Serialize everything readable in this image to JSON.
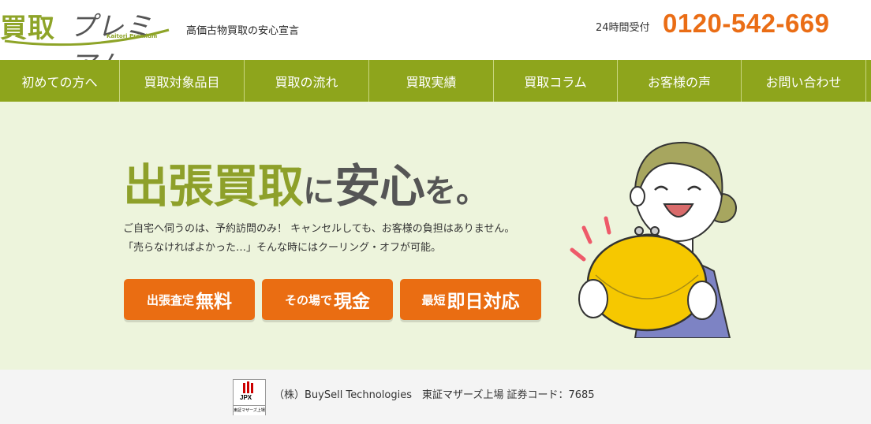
{
  "header": {
    "logo_kanji": "買取",
    "logo_kana": "プレミアム",
    "logo_roman": "Kaitori Premium",
    "tagline": "高価古物買取の安心宣言",
    "hours_label": "24時間受付",
    "phone": "0120-542-669"
  },
  "nav": {
    "items": [
      {
        "label": "初めての方へ"
      },
      {
        "label": "買取対象品目"
      },
      {
        "label": "買取の流れ"
      },
      {
        "label": "買取実績"
      },
      {
        "label": "買取コラム"
      },
      {
        "label": "お客様の声"
      },
      {
        "label": "お問い合わせ"
      }
    ]
  },
  "hero": {
    "headline_part1": "出張買取",
    "headline_part2": "に",
    "headline_part3": "安心",
    "headline_part4": "を。",
    "desc_line1": "ご自宅へ伺うのは、予約訪問のみ！ キャンセルしても、お客様の負担はありません。",
    "desc_line2": "「売らなければよかった…」そんな時にはクーリング・オフが可能。",
    "buttons": [
      {
        "small": "出張査定",
        "big": "無料"
      },
      {
        "small": "その場で",
        "big": "現金"
      },
      {
        "small": "最短",
        "big": "即日対応"
      }
    ]
  },
  "footer": {
    "jpx_label": "JPX",
    "jpx_sub": "東証マザーズ上場",
    "company": "（株）BuySell Technologies　東証マザーズ上場 証券コード：7685"
  },
  "colors": {
    "brand_green": "#8ea51c",
    "accent_orange": "#ea6d12",
    "hero_bg": "#edf4dc"
  }
}
